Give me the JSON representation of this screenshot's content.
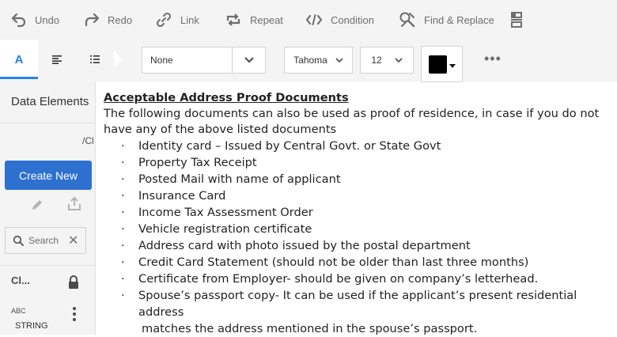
{
  "toolbar": {
    "undo_label": "Undo",
    "redo_label": "Redo",
    "link_label": "Link",
    "repeat_label": "Repeat",
    "condition_label": "Condition",
    "find_replace_label": "Find & Replace"
  },
  "format": {
    "tab_text_glyph": "A",
    "style_value": "None",
    "font_value": "Tahoma",
    "size_value": "12",
    "text_color": "#000000",
    "more_label": "•••"
  },
  "sidebar": {
    "title": "Data Elements",
    "path": "/Cl",
    "create_label": "Create New",
    "search_placeholder": "Search",
    "clear_glyph": "✕",
    "item_name": "Cl...",
    "item_type_badge": "ABC",
    "item_type": "STRING"
  },
  "document": {
    "heading": "Acceptable Address Proof Documents",
    "intro": "The following documents can also be used as proof of residence, in case if you do not have any of the above listed documents",
    "items": [
      "Identity card – Issued by Central Govt. or State Govt",
      "Property Tax Receipt",
      "Posted Mail with name of applicant",
      "Insurance Card",
      "Income Tax Assessment Order",
      "Vehicle registration certificate",
      "Address card with photo issued by the postal department",
      "Credit Card Statement (should not be older than last three months)",
      "Certificate from Employer- should be given on company’s letterhead."
    ],
    "last_item_line1": "Spouse’s passport copy- It can be used if the applicant’s present residential address",
    "last_item_line2": "matches the address mentioned in the spouse’s passport."
  },
  "colors": {
    "accent": "#2680eb",
    "create_button": "#2d70d0",
    "toolbar_bg": "#f4f4f4"
  },
  "icons": [
    "undo-icon",
    "redo-icon",
    "link-icon",
    "repeat-icon",
    "condition-icon",
    "find-replace-icon",
    "page-break-icon",
    "text-format-icon",
    "paragraph-align-icon",
    "list-icon",
    "chevron-down-icon",
    "more-icon",
    "pencil-icon",
    "share-icon",
    "search-icon",
    "close-icon",
    "lock-icon",
    "kebab-icon"
  ]
}
